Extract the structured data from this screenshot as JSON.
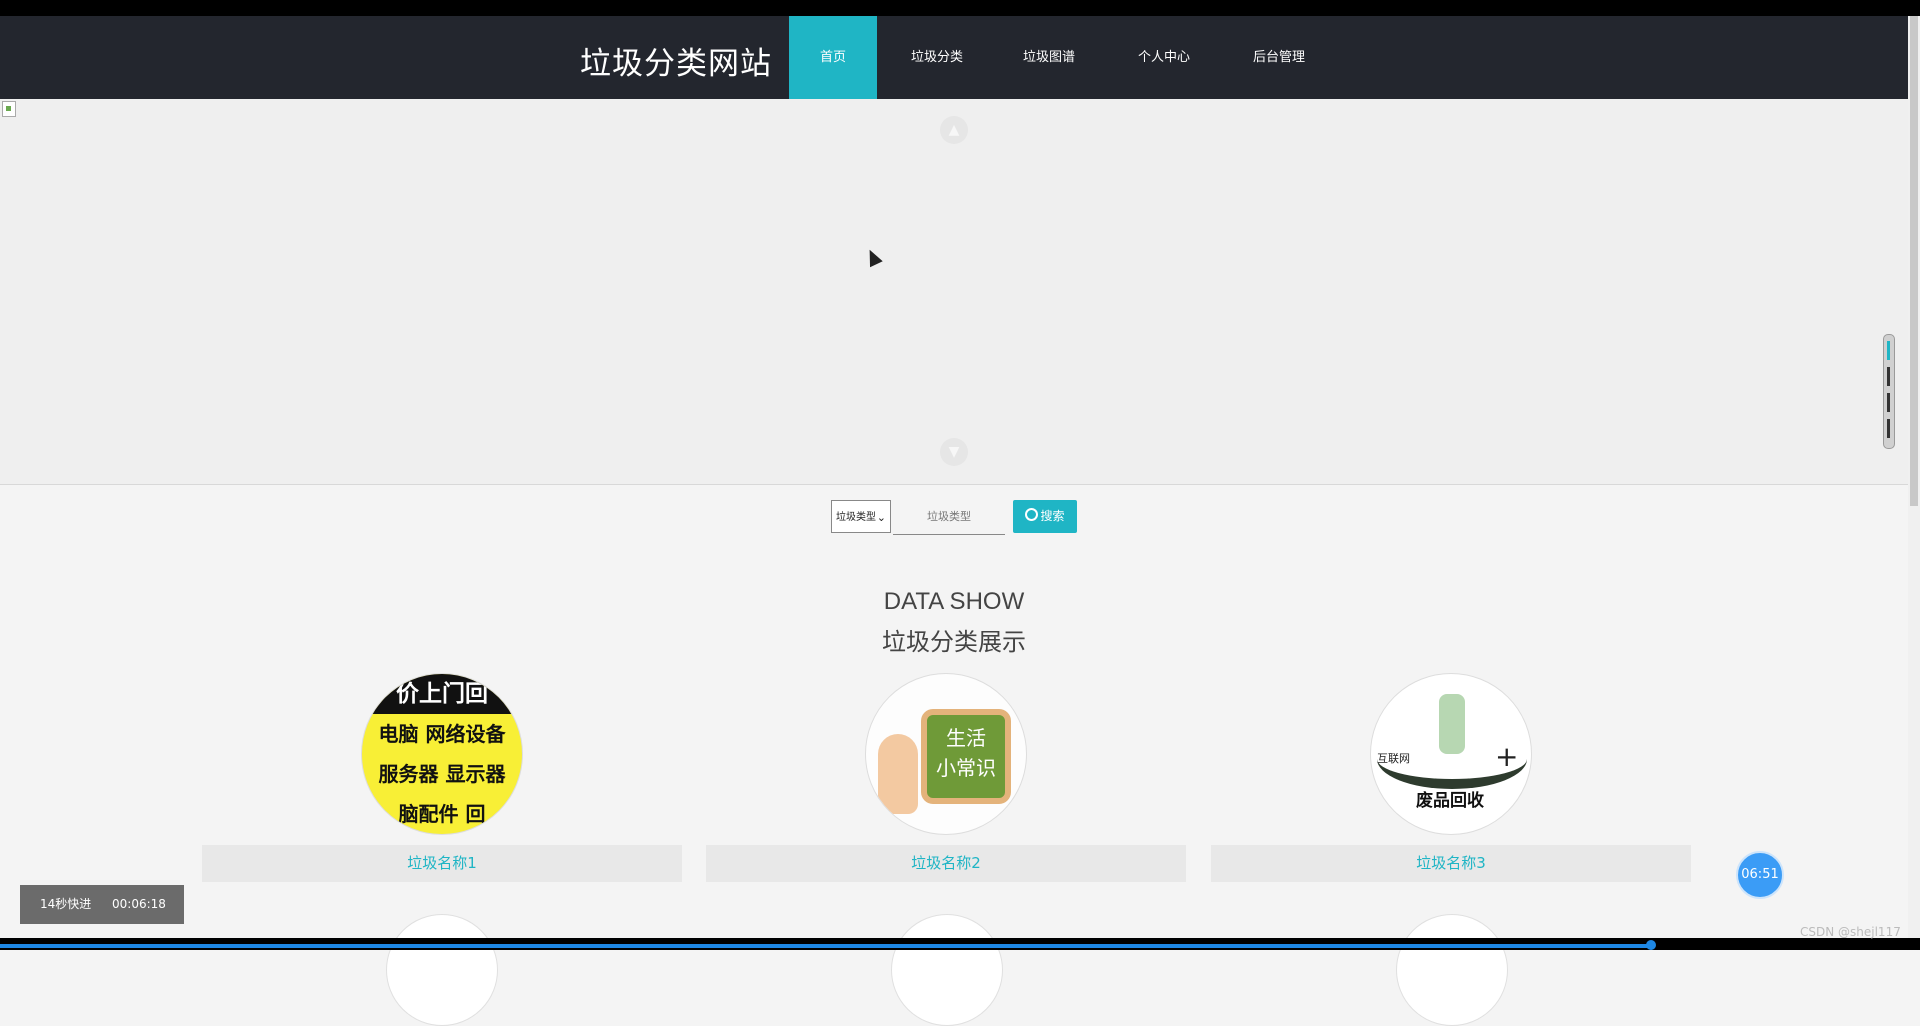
{
  "navbar": {
    "brand": "垃圾分类网站",
    "items": [
      "首页",
      "垃圾分类",
      "垃圾图谱",
      "个人中心",
      "后台管理"
    ],
    "active_index": 0
  },
  "search": {
    "select_value": "垃圾类型",
    "input_placeholder": "垃圾类型",
    "button_label": "搜索"
  },
  "section": {
    "title_en": "DATA SHOW",
    "title_cn": "垃圾分类展示"
  },
  "cards": [
    {
      "label": "垃圾名称1",
      "image_text": [
        "价上门回",
        "电脑 网络设备",
        "服务器 显示器",
        "脑配件 回"
      ]
    },
    {
      "label": "垃圾名称2",
      "image_text": [
        "生活",
        "小常识"
      ]
    },
    {
      "label": "垃圾名称3",
      "image_text": [
        "互联网",
        "废品回收",
        "+"
      ]
    }
  ],
  "video_overlay": {
    "speed_label": "14秒快进",
    "time": "00:06:18"
  },
  "timer_bubble": "06:51",
  "watermark": "CSDN @shejl117",
  "colors": {
    "accent": "#1fb5c5",
    "navbar_bg": "#23262e",
    "timer_blue": "#3b9cf6"
  },
  "playback_progress": 0.86
}
